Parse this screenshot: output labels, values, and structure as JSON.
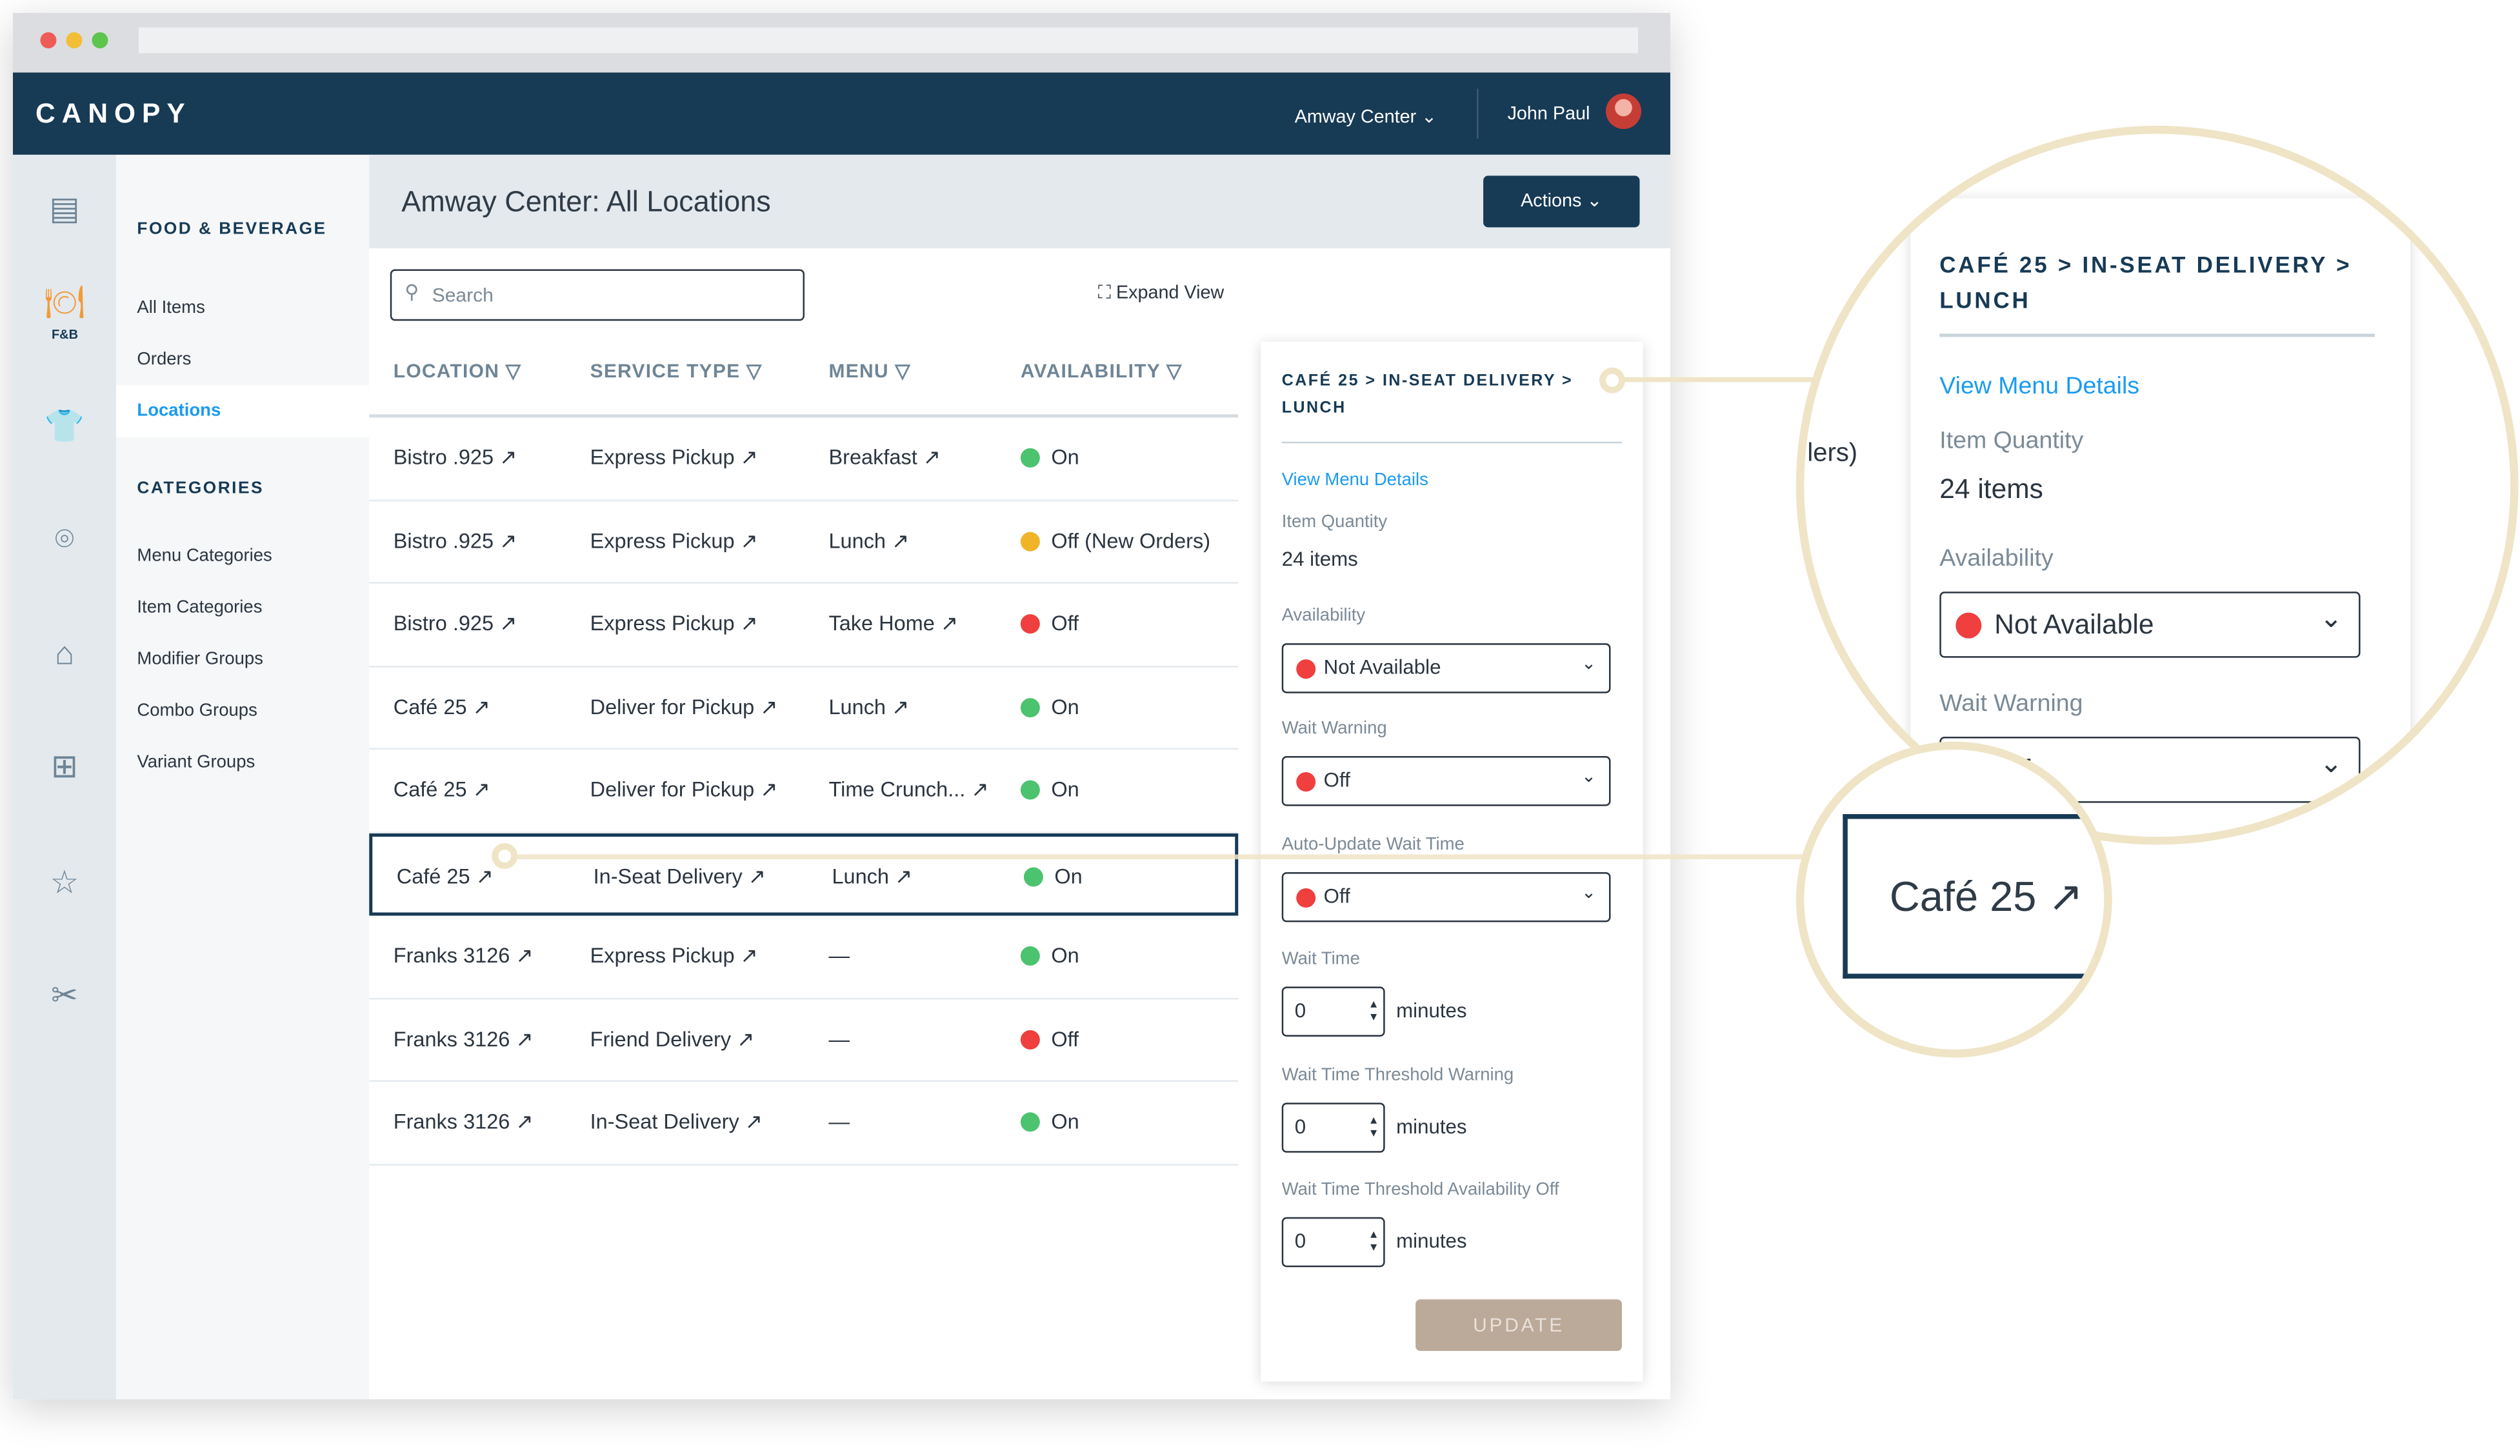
{
  "app": {
    "logo": "CANOPY",
    "venue": "Amway Center",
    "user": "John Paul"
  },
  "rail": {
    "fb_label": "F&B"
  },
  "sidebar": {
    "heading": "FOOD & BEVERAGE",
    "items": [
      "All Items",
      "Orders",
      "Locations"
    ],
    "categories_heading": "CATEGORIES",
    "categories": [
      "Menu Categories",
      "Item Categories",
      "Modifier Groups",
      "Combo Groups",
      "Variant Groups"
    ]
  },
  "main": {
    "title": "Amway Center: All Locations",
    "actions": "Actions",
    "search_placeholder": "Search",
    "expand": "Expand View"
  },
  "table": {
    "headers": [
      "LOCATION",
      "SERVICE TYPE",
      "MENU",
      "AVAILABILITY"
    ],
    "rows": [
      [
        "Bistro .925 ↗",
        "Express Pickup ↗",
        "Breakfast ↗",
        "On",
        "on"
      ],
      [
        "Bistro .925 ↗",
        "Express Pickup ↗",
        "Lunch ↗",
        "Off (New Orders)",
        "warn"
      ],
      [
        "Bistro .925 ↗",
        "Express Pickup ↗",
        "Take Home ↗",
        "Off",
        "off"
      ],
      [
        "Café 25 ↗",
        "Deliver for Pickup ↗",
        "Lunch ↗",
        "On",
        "on"
      ],
      [
        "Café 25 ↗",
        "Deliver for Pickup ↗",
        "Time Crunch... ↗",
        "On",
        "on"
      ],
      [
        "Café 25 ↗",
        "In-Seat Delivery ↗",
        "Lunch ↗",
        "On",
        "on"
      ],
      [
        "Franks 3126 ↗",
        "Express Pickup ↗",
        "—",
        "On",
        "on"
      ],
      [
        "Franks 3126 ↗",
        "Friend Delivery ↗",
        "—",
        "Off",
        "off"
      ],
      [
        "Franks 3126 ↗",
        "In-Seat Delivery ↗",
        "—",
        "On",
        "on"
      ]
    ]
  },
  "panel": {
    "breadcrumb": "CAFÉ 25 > IN-SEAT DELIVERY > LUNCH",
    "view_link": "View Menu Details",
    "qty_label": "Item Quantity",
    "qty": "24 items",
    "availability_label": "Availability",
    "availability": "Not Available",
    "wait_warning_label": "Wait Warning",
    "wait_warning": "Off",
    "auto_label": "Auto-Update Wait Time",
    "auto": "Off",
    "wait_time_label": "Wait Time",
    "wait_time": "0",
    "thr_warn_label": "Wait Time Threshold Warning",
    "thr_warn": "0",
    "thr_off_label": "Wait Time Threshold Availability Off",
    "thr_off": "0",
    "unit": "minutes",
    "update": "UPDATE"
  },
  "magnifier": {
    "partial_text": "lers)",
    "cell": "Café 25 ↗"
  },
  "colors": {
    "navy": "#173a55",
    "on": "#4cc36f",
    "warn": "#f0b429",
    "off": "#ef3f3f",
    "link": "#1a9bf0",
    "accent": "#efe4c6"
  }
}
